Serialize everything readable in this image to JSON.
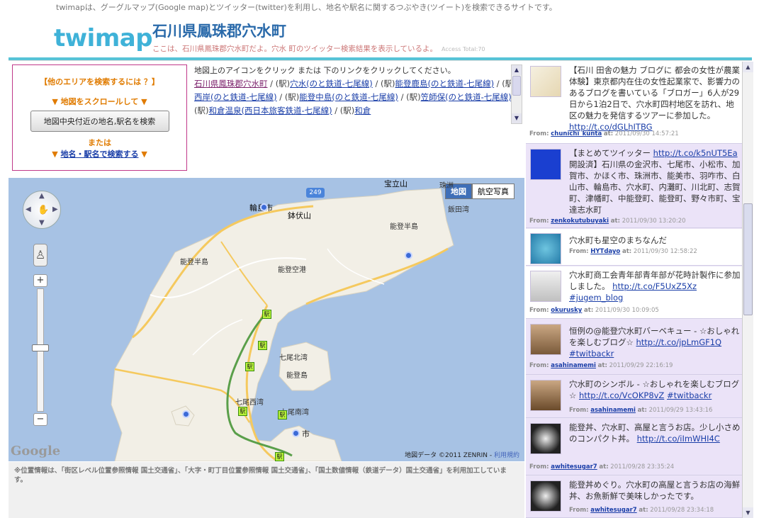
{
  "site": {
    "top_note": "twimapは、グーグルマップ(Google map)とツイッター(twitter)を利用し、地名や駅名に関するつぶやき(ツイート)を検索できるサイトです。",
    "logo": "twimap",
    "title": "石川県鳳珠郡穴水町",
    "subtitle": "ここは、石川県鳳珠郡穴水町だよ。穴水 町のツイッター検索結果を表示しているよ。",
    "access": "Access Total:70"
  },
  "search_box": {
    "heading": "【他のエリアを検索するには ？】",
    "scroll_hint": "▼ 地図をスクロールして ▼",
    "button_label": "地図中央付近の地名,駅名を検索",
    "or_label": "または",
    "link_label": "地名・駅名で検索する",
    "arrow": "▼"
  },
  "links": {
    "intro": "地図上のアイコンをクリック または 下のリンクをクリックしてください。",
    "items": [
      {
        "text": "石川県鳳珠郡穴水町",
        "prefix": ""
      },
      {
        "text": "穴水(のと鉄道-七尾線)",
        "prefix": "(駅)"
      },
      {
        "text": "能登鹿島(のと鉄道-七尾線)",
        "prefix": "(駅)"
      },
      {
        "text": "西岸(のと鉄道-七尾線)",
        "prefix": "(駅)"
      },
      {
        "text": "能登中島(のと鉄道-七尾線)",
        "prefix": "(駅)"
      },
      {
        "text": "笠師保(のと鉄道-七尾線)",
        "prefix": "(駅)"
      },
      {
        "text": "和倉温泉(西日本旅客鉄道-七尾線)",
        "prefix": "(駅)"
      },
      {
        "text": "和倉",
        "prefix": "(駅)"
      }
    ],
    "separator": " / "
  },
  "map": {
    "type_map": "地図",
    "type_satellite": "航空写真",
    "google": "Google",
    "copyright": "地図データ ©2011 ZENRIN - ",
    "terms": "利用規約",
    "route_number": "249",
    "station_glyph": "駅",
    "places": {
      "wajima": "輪島市",
      "hachibuse": "鉢伏山",
      "houryuu": "宝立山",
      "iida": "飯田湾",
      "noto_hanto_r": "能登半島",
      "noto_hanto_l": "能登半島",
      "airport": "能登空港",
      "nanao_north": "七尾北湾",
      "notojima": "能登島",
      "nanao_west": "七尾西湾",
      "nanao_south": "七尾南湾",
      "shi": "市",
      "partial": "珠洲"
    },
    "colors": {
      "sea": "#a7c2e4",
      "land": "#f2efe6",
      "road": "#f5c95e",
      "rail": "#5a9f4a"
    }
  },
  "footnote": "※位置情報は、「街区レベル位置参照情報 国土交通省」、「大字・町丁目位置参照情報 国土交通省」、「国土数値情報（鉄道データ）国土交通省」を利用加工しています。",
  "tweets": [
    {
      "text": "【石川 田舎の魅力 ブログに 都会の女性が農業体験】東京都内在住の女性起業家で、影響力のあるブログを書いている「ブロガー」6人が29日から1泊2日で、穴水町四村地区を訪れ、地区の魅力を発信するツアーに参加した。",
      "link": "http://t.co/dGLhITBG",
      "user": "chunichi_kunta",
      "time": "2011/09/30 14:57:21"
    },
    {
      "text": "【まとめてツイッター",
      "link": "http://t.co/k5nUT5Ea",
      "text2": "開設済】石川県の金沢市、七尾市、小松市、加賀市、かほく市、珠洲市、能美市、羽咋市、白山市、輪島市、穴水町、内灘町、川北町、志賀町、津幡町、中能登町、能登町、野々市町、宝達志水町",
      "user": "zenkokutubuyaki",
      "time": "2011/09/30 13:20:20"
    },
    {
      "text": "穴水町も星空のまちなんだ",
      "user": "HYTdayo",
      "time": "2011/09/30 12:58:22"
    },
    {
      "text": "穴水町商工会青年部青年部が花時計製作に参加しました。",
      "link": "http://t.co/F5UxZ5Xz",
      "link2": "#jugem_blog",
      "user": "okurusky",
      "time": "2011/09/30 10:09:05"
    },
    {
      "text": "恒例の@能登穴水町バーベキュー - ☆おしゃれを楽しむブログ☆",
      "link": "http://t.co/jpLmGF1Q",
      "link2": "#twitbackr",
      "user": "asahinamemi",
      "time": "2011/09/29 22:16:19"
    },
    {
      "text": "穴水町のシンボル - ☆おしゃれを楽しむブログ☆",
      "link": "http://t.co/VcOKP8vZ",
      "link2": "#twitbackr",
      "user": "asahinamemi",
      "time": "2011/09/29 13:43:16"
    },
    {
      "text": "能登丼、穴水町、高屋と言うお店。少し小さめのコンパクト丼。",
      "link": "http://t.co/iImWHI4C",
      "user": "awhitesugar7",
      "time": "2011/09/28 23:35:24"
    },
    {
      "text": "能登丼めぐり。穴水町の高屋と言うお店の海鮮丼、お魚新鮮で美味しかったです。",
      "user": "awhitesugar7",
      "time": "2011/09/28 23:34:18"
    }
  ],
  "labels": {
    "from": "From:",
    "at": "at:"
  }
}
